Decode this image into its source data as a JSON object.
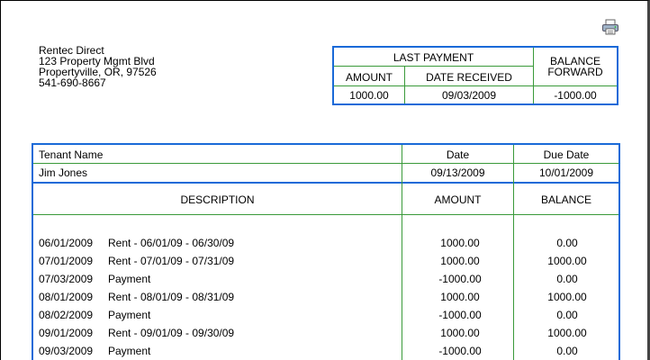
{
  "company": {
    "name": "Rentec Direct",
    "address1": "123 Property Mgmt Blvd",
    "address2": "Propertyville, OR, 97526",
    "phone": "541-690-8667"
  },
  "last_payment": {
    "heading": "LAST PAYMENT",
    "amount_label": "AMOUNT",
    "date_label": "DATE RECEIVED",
    "balance_label_line1": "BALANCE",
    "balance_label_line2": "FORWARD",
    "amount": "1000.00",
    "date": "09/03/2009",
    "balance": "-1000.00"
  },
  "statement": {
    "tenant_label": "Tenant Name",
    "date_label": "Date",
    "due_date_label": "Due Date",
    "tenant_name": "Jim Jones",
    "date": "09/13/2009",
    "due_date": "10/01/2009",
    "description_header": "DESCRIPTION",
    "amount_header": "AMOUNT",
    "balance_header": "BALANCE",
    "transactions": [
      {
        "date": "06/01/2009",
        "description": "Rent - 06/01/09 - 06/30/09",
        "amount": "1000.00",
        "balance": "0.00"
      },
      {
        "date": "07/01/2009",
        "description": "Rent - 07/01/09 - 07/31/09",
        "amount": "1000.00",
        "balance": "1000.00"
      },
      {
        "date": "07/03/2009",
        "description": "Payment",
        "amount": "-1000.00",
        "balance": "0.00"
      },
      {
        "date": "08/01/2009",
        "description": "Rent - 08/01/09 - 08/31/09",
        "amount": "1000.00",
        "balance": "1000.00"
      },
      {
        "date": "08/02/2009",
        "description": "Payment",
        "amount": "-1000.00",
        "balance": "0.00"
      },
      {
        "date": "09/01/2009",
        "description": "Rent - 09/01/09 - 09/30/09",
        "amount": "1000.00",
        "balance": "1000.00"
      },
      {
        "date": "09/03/2009",
        "description": "Payment",
        "amount": "-1000.00",
        "balance": "0.00"
      }
    ]
  },
  "icons": {
    "print": "printer-icon"
  },
  "colors": {
    "border_blue": "#1a6ad8",
    "line_green": "#3a9a3a"
  }
}
